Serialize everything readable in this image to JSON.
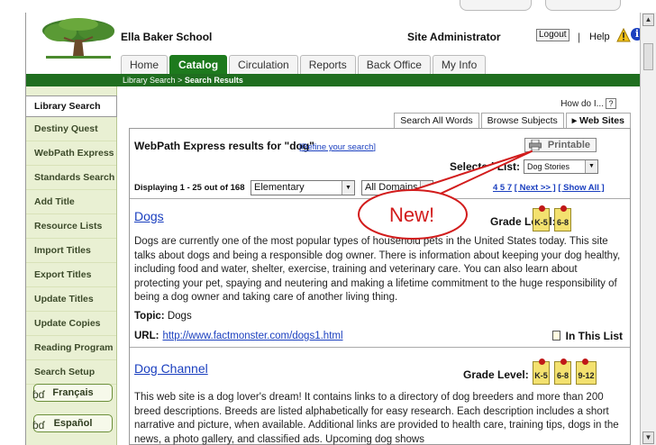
{
  "header": {
    "school_name": "Ella Baker School",
    "user_role": "Site Administrator",
    "logout_label": "Logout",
    "separator": "|",
    "help_label": "Help",
    "info_glyph": "i",
    "icons": {
      "logo": "tree-logo-icon",
      "warning": "warning-icon",
      "info": "info-icon"
    }
  },
  "tabs": [
    {
      "label": "Home",
      "active": false
    },
    {
      "label": "Catalog",
      "active": true
    },
    {
      "label": "Circulation",
      "active": false
    },
    {
      "label": "Reports",
      "active": false
    },
    {
      "label": "Back Office",
      "active": false
    },
    {
      "label": "My Info",
      "active": false
    }
  ],
  "breadcrumb": {
    "parent": "Library Search",
    "separator": ">",
    "current": "Search Results"
  },
  "sidebar": {
    "items": [
      {
        "label": "Library Search",
        "active": true
      },
      {
        "label": "Destiny Quest",
        "active": false
      },
      {
        "label": "WebPath Express",
        "active": false
      },
      {
        "label": "Standards Search",
        "active": false
      },
      {
        "label": "Add Title",
        "active": false
      },
      {
        "label": "Resource Lists",
        "active": false
      },
      {
        "label": "Import Titles",
        "active": false
      },
      {
        "label": "Export Titles",
        "active": false
      },
      {
        "label": "Update Titles",
        "active": false
      },
      {
        "label": "Update Copies",
        "active": false
      },
      {
        "label": "Reading Program",
        "active": false
      },
      {
        "label": "Search Setup",
        "active": false
      }
    ],
    "languages": [
      {
        "label": "Français",
        "glyph": "ɓɗ"
      },
      {
        "label": "Español",
        "glyph": "ɓɗ"
      }
    ]
  },
  "howdoi": {
    "label": "How do I...",
    "help_glyph": "?"
  },
  "subtabs": [
    {
      "label": "Search All Words",
      "active": false
    },
    {
      "label": "Browse Subjects",
      "active": false
    },
    {
      "label": "Web Sites",
      "active": true,
      "marker": "▸"
    }
  ],
  "results": {
    "title": "WebPath Express results for \"dog\"",
    "refine_label": "Refine your search",
    "printable_label": "Printable",
    "selected_list_label": "Selected List:",
    "selected_list_value": "Dog Stories",
    "displaying": "Displaying 1 - 25 out of 168",
    "level_select": "Elementary",
    "domain_select": "All Domains",
    "pager": {
      "pages": "4 5 7",
      "next_label": "[ Next >> ]",
      "show_all_label": "[ Show All ]"
    },
    "items": [
      {
        "title": "Dogs",
        "grade_label": "Grade Level:",
        "grades": [
          "K-5",
          "6-8"
        ],
        "description": "Dogs are currently one of the most popular types of household pets in the United States today. This site talks about dogs and being a responsible dog owner. There is information about keeping your dog healthy, including food and water, shelter, exercise, training and veterinary care. You can also learn about protecting your pet, spaying and neutering and making a lifetime commitment to the huge responsibility of being a dog owner and taking care of another living thing.",
        "topic_label": "Topic:",
        "topic": "Dogs",
        "url_label": "URL:",
        "url": "http://www.factmonster.com/dogs1.html",
        "in_list_label": "In This List"
      },
      {
        "title": "Dog Channel",
        "grade_label": "Grade Level:",
        "grades": [
          "K-5",
          "6-8",
          "9-12"
        ],
        "description": "This web site is a dog lover's dream! It contains links to a directory of dog breeders and more than 200 breed descriptions. Breeds are listed alphabetically for easy research. Each description includes a short narrative and picture, when available. Additional links are provided to health care, training tips, dogs in the news, a photo gallery, and classified ads. Upcoming dog shows"
      }
    ]
  },
  "callout": {
    "text": "New!",
    "color": "#d21c1c"
  },
  "colors": {
    "brand_green": "#1d7a1d",
    "link_blue": "#1a3fbf",
    "sidebar_bg": "#e9f0d3",
    "badge_yellow": "#f3e16f"
  }
}
